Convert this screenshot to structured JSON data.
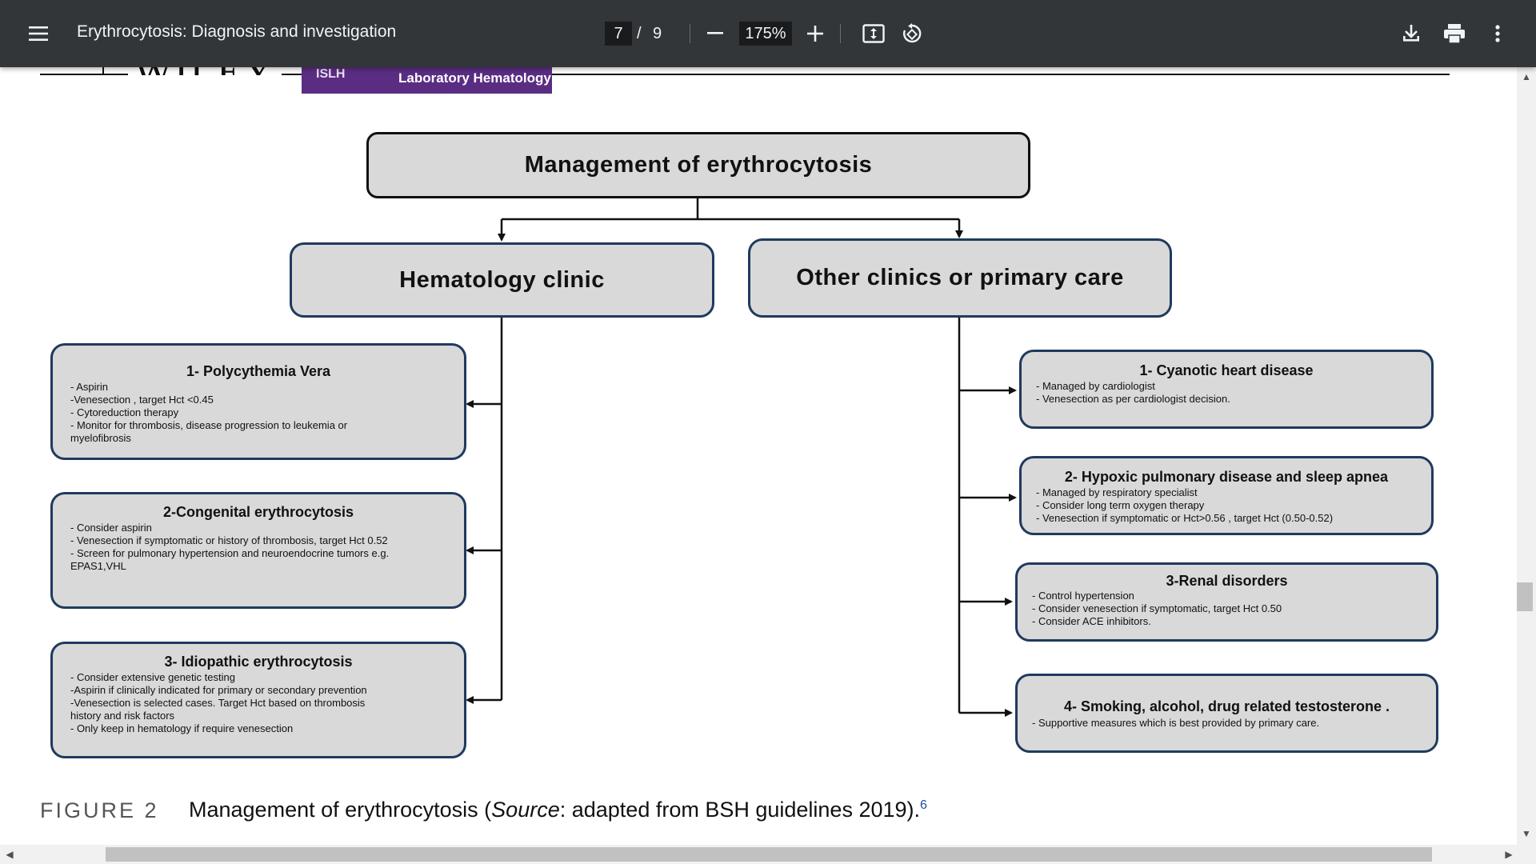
{
  "toolbar": {
    "title": "Erythrocytosis: Diagnosis and investigation",
    "page_current": "7",
    "page_separator": "/",
    "page_total": "9",
    "zoom": "175%",
    "icons": [
      "menu-icon",
      "zoom-out-icon",
      "zoom-in-icon",
      "fit-page-icon",
      "rotate-icon",
      "download-icon",
      "print-icon",
      "more-options-icon"
    ]
  },
  "header": {
    "publisher": "WILEY",
    "society_logo": "ISLH",
    "journal": "Laboratory Hematology"
  },
  "diagram": {
    "root": "Management of erythrocytosis",
    "branches": [
      {
        "title": "Hematology clinic",
        "children": [
          {
            "title": "1- Polycythemia Vera",
            "body": "- Aspirin\n-Venesection , target Hct <0.45\n- Cytoreduction   therapy\n- Monitor for thrombosis, disease progression to leukemia or\nmyelofibrosis"
          },
          {
            "title": "2-Congenital erythrocytosis",
            "body": "- Consider aspirin\n- Venesection  if symptomatic or  history of thrombosis, target  Hct 0.52\n- Screen for pulmonary hypertension and neuroendocrine tumors    e.g.\nEPAS1,VHL"
          },
          {
            "title": "3- Idiopathic erythrocytosis",
            "body": "- Consider extensive genetic testing\n-Aspirin if clinically indicated for primary or secondary prevention\n-Venesection is selected cases. Target   Hct based on thrombosis\nhistory and risk factors\n- Only keep in hematology if require venesection"
          }
        ]
      },
      {
        "title": "Other clinics or primary care",
        "children": [
          {
            "title": "1- Cyanotic heart disease",
            "body": "- Managed by cardiologist\n- Venesection  as per cardiologist decision."
          },
          {
            "title": "2- Hypoxic pulmonary disease and sleep apnea",
            "body": "- Managed by respiratory specialist\n- Consider  long term oxygen therapy\n- Venesection  if symptomatic or  Hct>0.56 , target Hct (0.50-0.52)"
          },
          {
            "title": "3-Renal disorders",
            "body": "- Control hypertension\n- Consider  venesection if symptomatic, target   Hct 0.50\n- Consider  ACE inhibitors."
          },
          {
            "title": "4- Smoking, alcohol, drug related testosterone .",
            "body": "- Supportive measures which is best provided by primary care."
          }
        ]
      }
    ]
  },
  "caption": {
    "label": "FIGURE 2",
    "text_before": "Management of erythrocytosis (",
    "source_word": "Source",
    "text_after": ": adapted from BSH guidelines 2019).",
    "reference": "6"
  },
  "colors": {
    "toolbar_bg": "#323639",
    "box_fill": "#d9d9d9",
    "box_border": "#1f3a5f",
    "badge": "#5a2d82"
  }
}
